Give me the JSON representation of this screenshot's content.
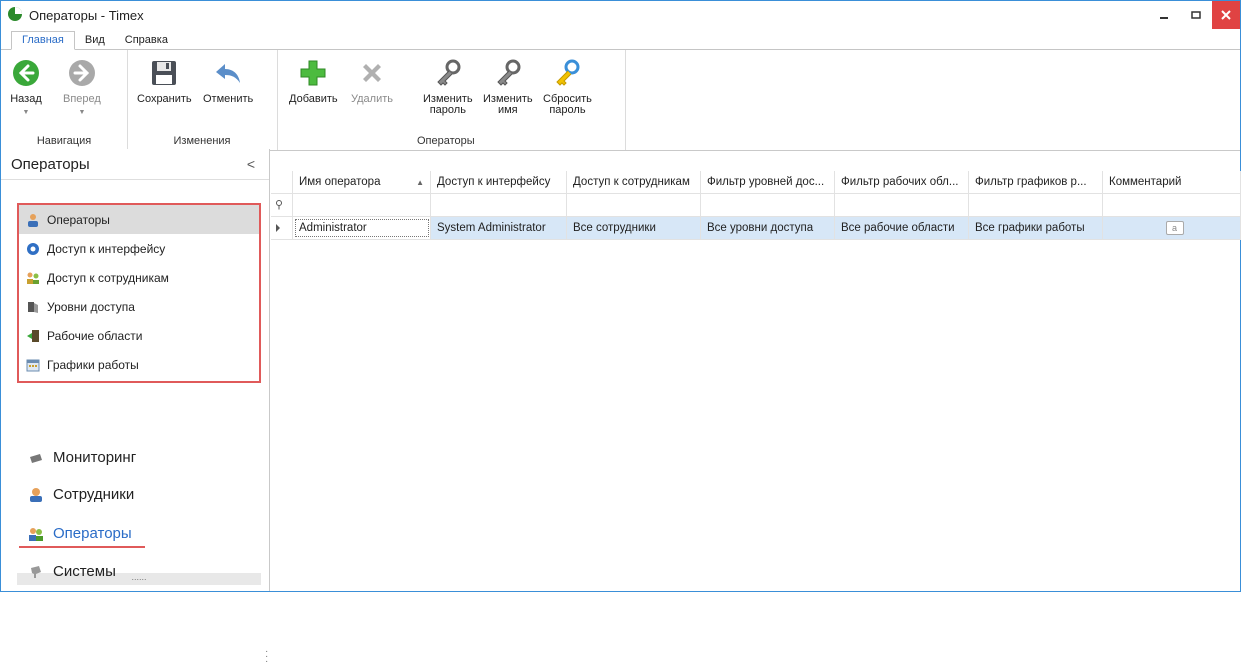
{
  "window": {
    "title": "Операторы - Timex"
  },
  "menu": {
    "tabs": [
      "Главная",
      "Вид",
      "Справка"
    ]
  },
  "ribbon": {
    "groups": {
      "navigation": "Навигация",
      "changes": "Изменения",
      "operators": "Операторы"
    },
    "buttons": {
      "back": "Назад",
      "forward": "Вперед",
      "save": "Сохранить",
      "cancel": "Отменить",
      "add": "Добавить",
      "delete": "Удалить",
      "change_password": [
        "Изменить",
        "пароль"
      ],
      "change_name": [
        "Изменить",
        "имя"
      ],
      "reset_password": [
        "Сбросить",
        "пароль"
      ]
    }
  },
  "sidebar": {
    "title": "Операторы",
    "collapse": "<",
    "items": [
      {
        "label": "Операторы",
        "icon": "operator-icon"
      },
      {
        "label": "Доступ к интерфейсу",
        "icon": "interface-access-icon"
      },
      {
        "label": "Доступ к сотрудникам",
        "icon": "employee-access-icon"
      },
      {
        "label": "Уровни доступа",
        "icon": "access-level-icon"
      },
      {
        "label": "Рабочие области",
        "icon": "work-area-icon"
      },
      {
        "label": "Графики работы",
        "icon": "schedule-icon"
      }
    ],
    "splitter": "......",
    "modules": [
      {
        "label": "Мониторинг",
        "icon": "monitor-icon"
      },
      {
        "label": "Сотрудники",
        "icon": "employees-icon"
      },
      {
        "label": "Операторы",
        "icon": "operators-icon"
      },
      {
        "label": "Системы",
        "icon": "systems-icon"
      }
    ]
  },
  "grid": {
    "columns": [
      "Имя оператора",
      "Доступ к интерфейсу",
      "Доступ к сотрудникам",
      "Фильтр уровней дос...",
      "Фильтр рабочих обл...",
      "Фильтр графиков р...",
      "Комментарий"
    ],
    "filter_icon": "filter-row-icon",
    "rows": [
      [
        "Administrator",
        "System Administrator",
        "Все сотрудники",
        "Все уровни доступа",
        "Все рабочие области",
        "Все графики работы",
        ""
      ]
    ],
    "memo_glyph": "a"
  },
  "colors": {
    "accent": "#2a6cc7",
    "selection": "#d7e7f7",
    "highlight_border": "#e05a5a",
    "close": "#e04343"
  }
}
